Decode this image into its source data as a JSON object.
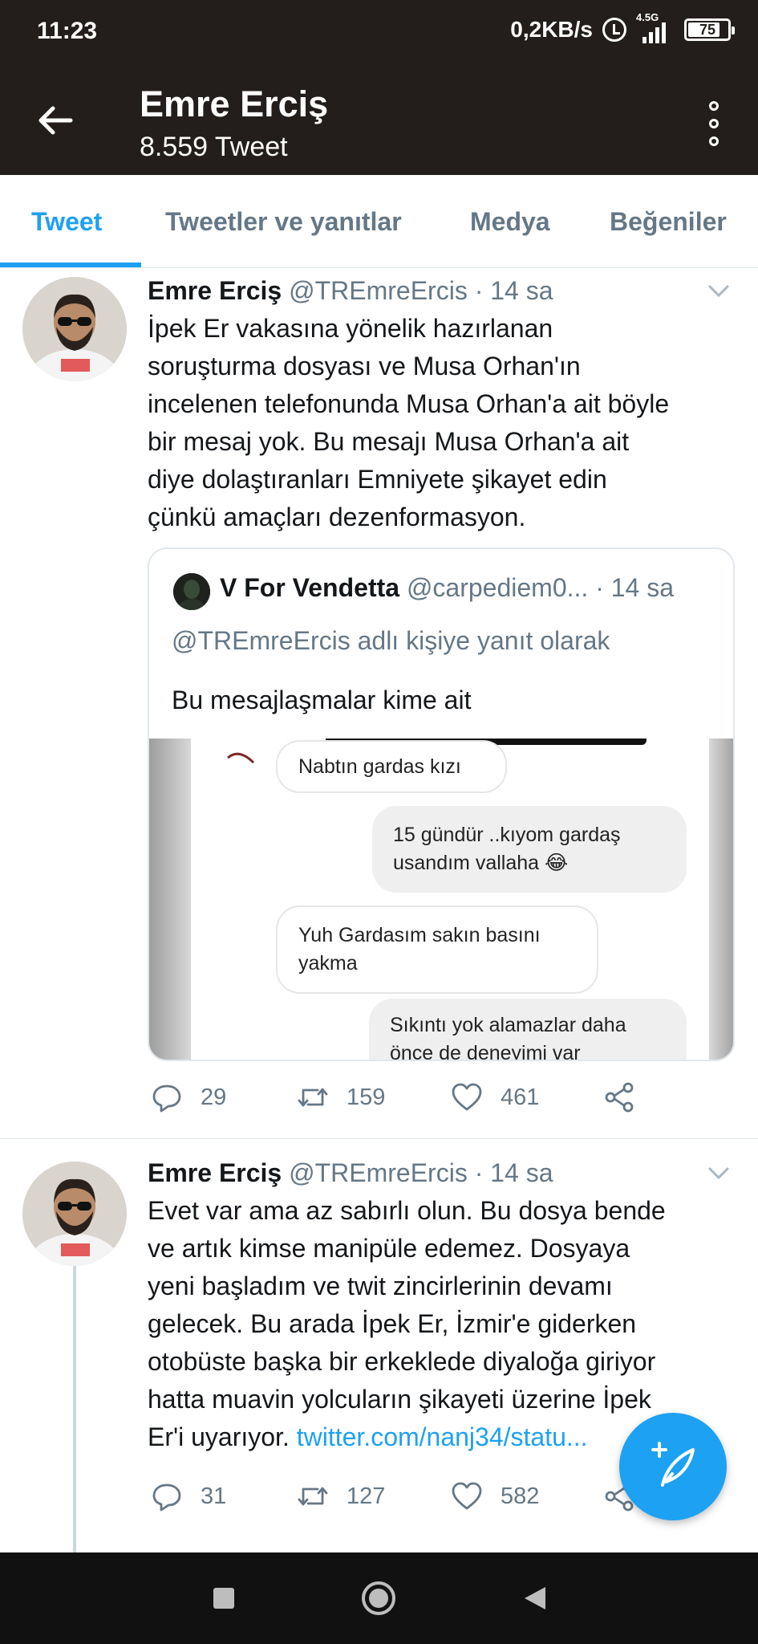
{
  "status_bar": {
    "time": "11:23",
    "net_speed": "0,2KB/s",
    "network_type": "4.5G",
    "battery": "75",
    "alarm_icon": "alarm-clock-icon",
    "signal_icon": "signal-bars-icon"
  },
  "header": {
    "title": "Emre Erciş",
    "subtitle": "8.559 Tweet",
    "back_icon": "arrow-left-icon",
    "menu_icon": "more-vertical-icon"
  },
  "tabs": [
    {
      "label": "Tweet",
      "active": true
    },
    {
      "label": "Tweetler ve yanıtlar",
      "active": false
    },
    {
      "label": "Medya",
      "active": false
    },
    {
      "label": "Beğeniler",
      "active": false
    }
  ],
  "colors": {
    "accent": "#1da1f2",
    "header_bg": "#231e1b",
    "secondary_text": "#657786"
  },
  "tweets": [
    {
      "author_name": "Emre Erciş",
      "handle": "@TREmreErcis",
      "time": "· 14 sa",
      "text_lines": [
        "İpek Er vakasına yönelik hazırlanan",
        "soruşturma dosyası ve Musa Orhan'ın",
        "incelenen telefonunda Musa Orhan'a ait böyle",
        "bir mesaj yok. Bu mesajı Musa Orhan'a ait",
        "diye dolaştıranları Emniyete şikayet edin",
        "çünkü amaçları dezenformasyon."
      ],
      "quote": {
        "author_name": "V For Vendetta",
        "handle": "@carpediem0...",
        "time": "· 14 sa",
        "reply_to": "@TREmreErcis adlı kişiye yanıt olarak",
        "text": "Bu mesajlaşmalar kime ait",
        "chat_messages": [
          {
            "side": "in",
            "lines": [
              "Nabtın gardas kızı"
            ]
          },
          {
            "side": "out",
            "lines": [
              "15 gündür ..kıyom gardaş",
              "usandım vallaha 😂"
            ]
          },
          {
            "side": "in",
            "lines": [
              "Yuh Gardasım sakın basını",
              "yakma"
            ]
          },
          {
            "side": "out",
            "lines": [
              "Sıkıntı yok alamazlar daha",
              "önce de deneyimi var"
            ]
          }
        ]
      },
      "replies": "29",
      "retweets": "159",
      "likes": "461"
    },
    {
      "author_name": "Emre Erciş",
      "handle": "@TREmreErcis",
      "time": "· 14 sa",
      "text_lines": [
        "Evet var ama az sabırlı olun. Bu dosya bende",
        "ve artık kimse manipüle edemez. Dosyaya",
        "yeni başladım ve twit zincirlerinin devamı",
        "gelecek. Bu arada İpek Er, İzmir'e giderken",
        "otobüste başka bir erkeklede diyaloğa giriyor",
        "hatta muavin yolcuların şikayeti üzerine İpek"
      ],
      "last_line_text": "Er'i uyarıyor.",
      "link": "twitter.com/nanj34/statu...",
      "replies": "31",
      "retweets": "127",
      "likes": "582"
    }
  ],
  "fab_icon": "compose-feather-icon",
  "nav": {
    "recents_icon": "square-recents-icon",
    "home_icon": "circle-home-icon",
    "back_icon": "triangle-back-icon"
  }
}
